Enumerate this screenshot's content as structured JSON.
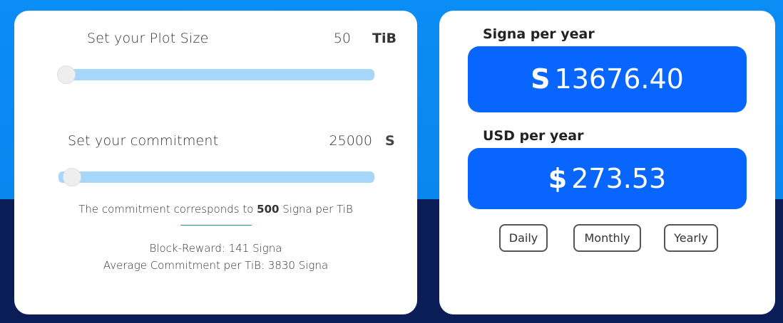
{
  "plot_size": {
    "label": "Set your Plot Size",
    "value": "50",
    "unit": "TiB",
    "slider_fraction": 0.0
  },
  "commitment": {
    "label": "Set your commitment",
    "value": "25000",
    "unit_icon": "signa-icon",
    "unit_glyph": "S",
    "slider_fraction": 0.02
  },
  "commitment_note": {
    "prefix": "The commitment corresponds to ",
    "amount": "500",
    "suffix": " Signa per TiB"
  },
  "block_reward": "Block-Reward: 141 Signa",
  "average_commitment": "Average Commitment per TiB: 3830 Signa",
  "results": {
    "signa_heading": "Signa per year",
    "signa_symbol": "S",
    "signa_value": "13676.40",
    "usd_heading": "USD per year",
    "usd_symbol": "$",
    "usd_value": "273.53"
  },
  "period_buttons": {
    "daily": "Daily",
    "monthly": "Monthly",
    "yearly": "Yearly"
  },
  "colors": {
    "accent_blue": "#0866ff",
    "slider_track": "#a7d6fb",
    "background_top": "#0a8df5",
    "background_bottom": "#0b1d57"
  }
}
